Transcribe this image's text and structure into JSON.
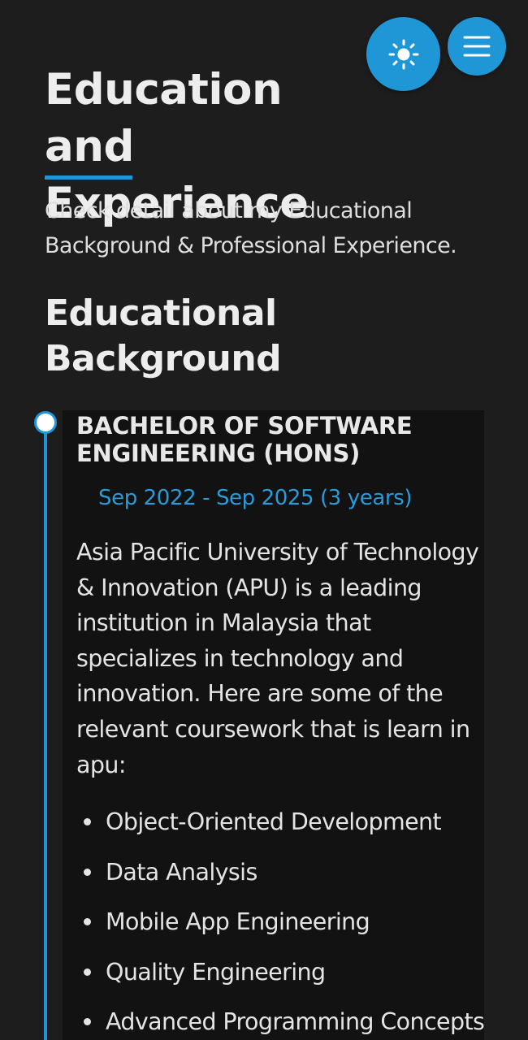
{
  "header": {
    "theme_toggle_icon": "sun-icon",
    "menu_icon": "hamburger-menu-icon"
  },
  "section": {
    "title": "Education and Experience",
    "description": "Check detail about my Educational Background & Professional Experience."
  },
  "education": {
    "heading": "Educational Background",
    "items": [
      {
        "degree": "BACHELOR OF SOFTWARE ENGINEERING (HONS)",
        "dates": "Sep 2022 - Sep 2025 (3 years)",
        "description": "Asia Pacific University of Technology & Innovation (APU) is a leading institution in Malaysia that specializes in technology and innovation. Here are some of the relevant coursework that is learn in apu:",
        "courses": [
          "Object-Oriented Development",
          "Data Analysis",
          "Mobile App Engineering",
          "Quality Engineering",
          "Advanced Programming Concepts"
        ]
      }
    ]
  },
  "colors": {
    "accent": "#1f97d6",
    "background": "#1d1d1d",
    "card_background": "#121212",
    "text": "#e6e6e6"
  }
}
